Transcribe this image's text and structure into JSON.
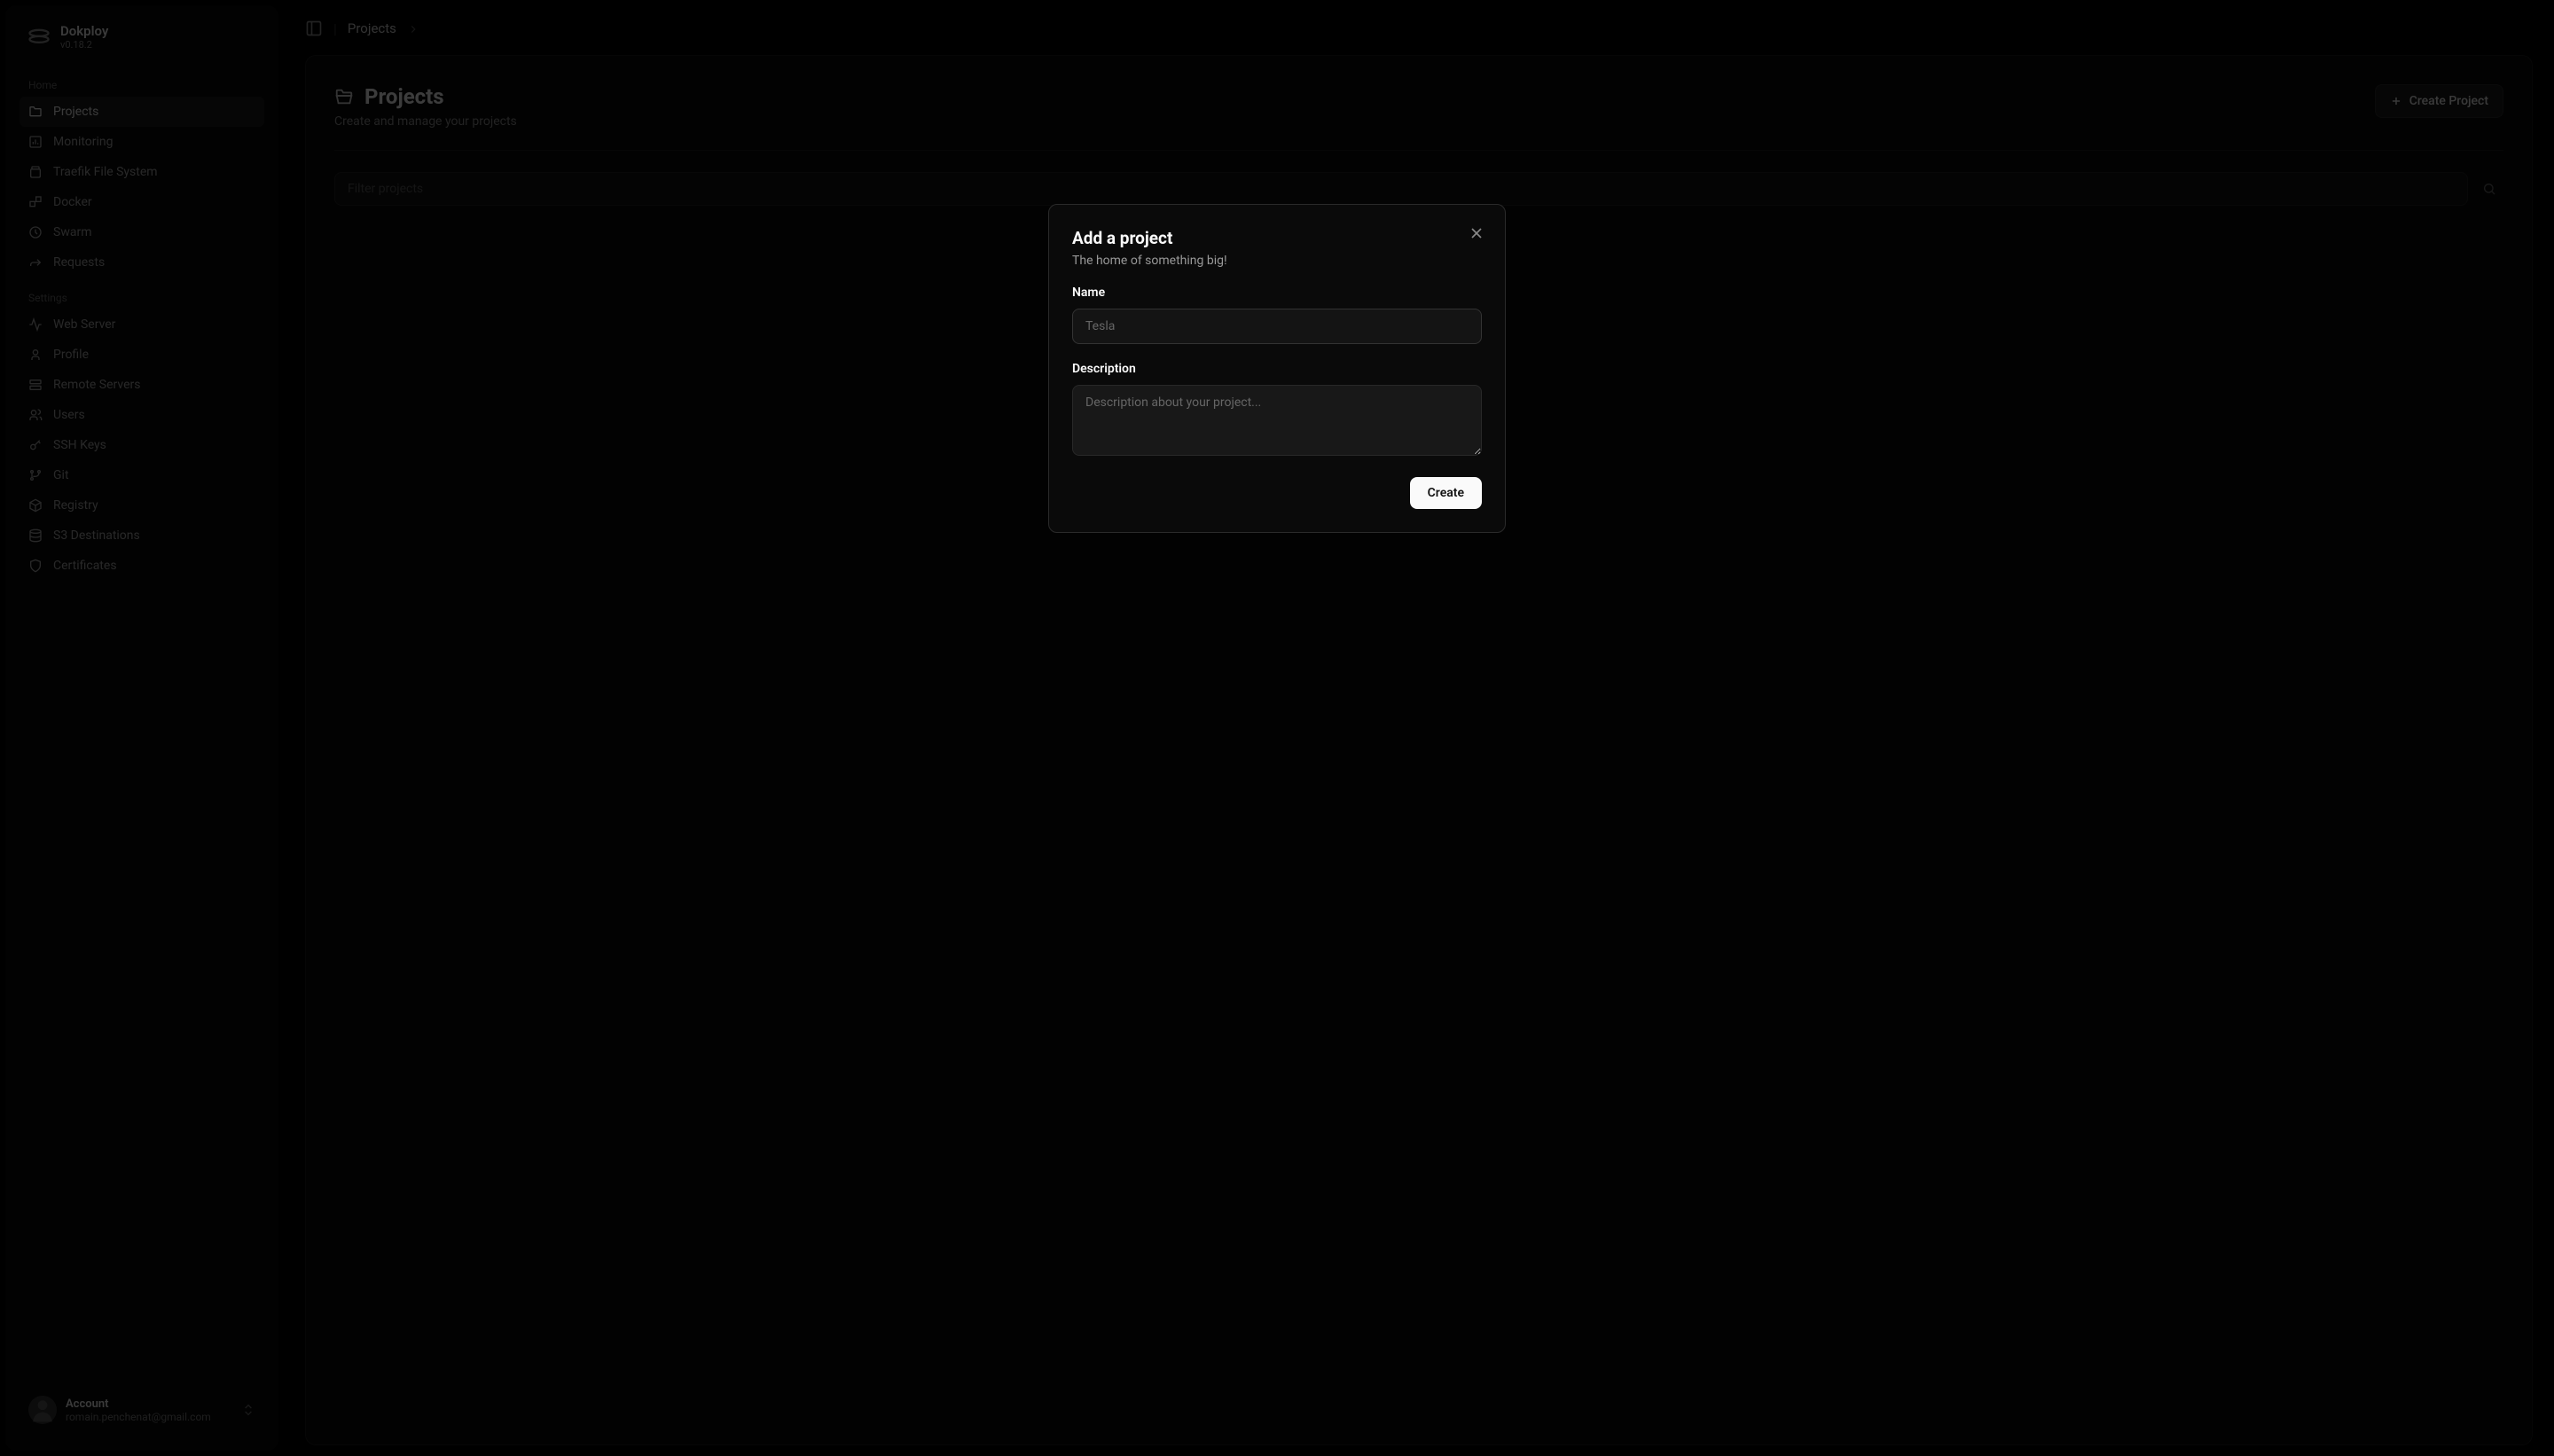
{
  "brand": {
    "name": "Dokploy",
    "version": "v0.18.2"
  },
  "sidebar": {
    "sections": {
      "home": {
        "label": "Home",
        "items": [
          {
            "label": "Projects",
            "icon": "folder-icon",
            "active": true
          },
          {
            "label": "Monitoring",
            "icon": "bar-chart-icon"
          },
          {
            "label": "Traefik File System",
            "icon": "files-icon"
          },
          {
            "label": "Docker",
            "icon": "blocks-icon"
          },
          {
            "label": "Swarm",
            "icon": "clock-icon"
          },
          {
            "label": "Requests",
            "icon": "forward-icon"
          }
        ]
      },
      "settings": {
        "label": "Settings",
        "items": [
          {
            "label": "Web Server",
            "icon": "activity-icon"
          },
          {
            "label": "Profile",
            "icon": "user-icon"
          },
          {
            "label": "Remote Servers",
            "icon": "server-icon"
          },
          {
            "label": "Users",
            "icon": "users-icon"
          },
          {
            "label": "SSH Keys",
            "icon": "key-icon"
          },
          {
            "label": "Git",
            "icon": "git-branch-icon"
          },
          {
            "label": "Registry",
            "icon": "package-icon"
          },
          {
            "label": "S3 Destinations",
            "icon": "database-icon"
          },
          {
            "label": "Certificates",
            "icon": "shield-icon"
          }
        ]
      }
    },
    "account": {
      "label": "Account",
      "email": "romain.penchenat@gmail.com"
    }
  },
  "breadcrumb": {
    "current": "Projects"
  },
  "page": {
    "title": "Projects",
    "subtitle": "Create and manage your projects",
    "createButton": "Create Project",
    "filterPlaceholder": "Filter projects"
  },
  "modal": {
    "title": "Add a project",
    "subtitle": "The home of something big!",
    "nameLabel": "Name",
    "namePlaceholder": "Tesla",
    "nameValue": "",
    "descriptionLabel": "Description",
    "descriptionPlaceholder": "Description about your project...",
    "descriptionValue": "",
    "submitButton": "Create"
  }
}
